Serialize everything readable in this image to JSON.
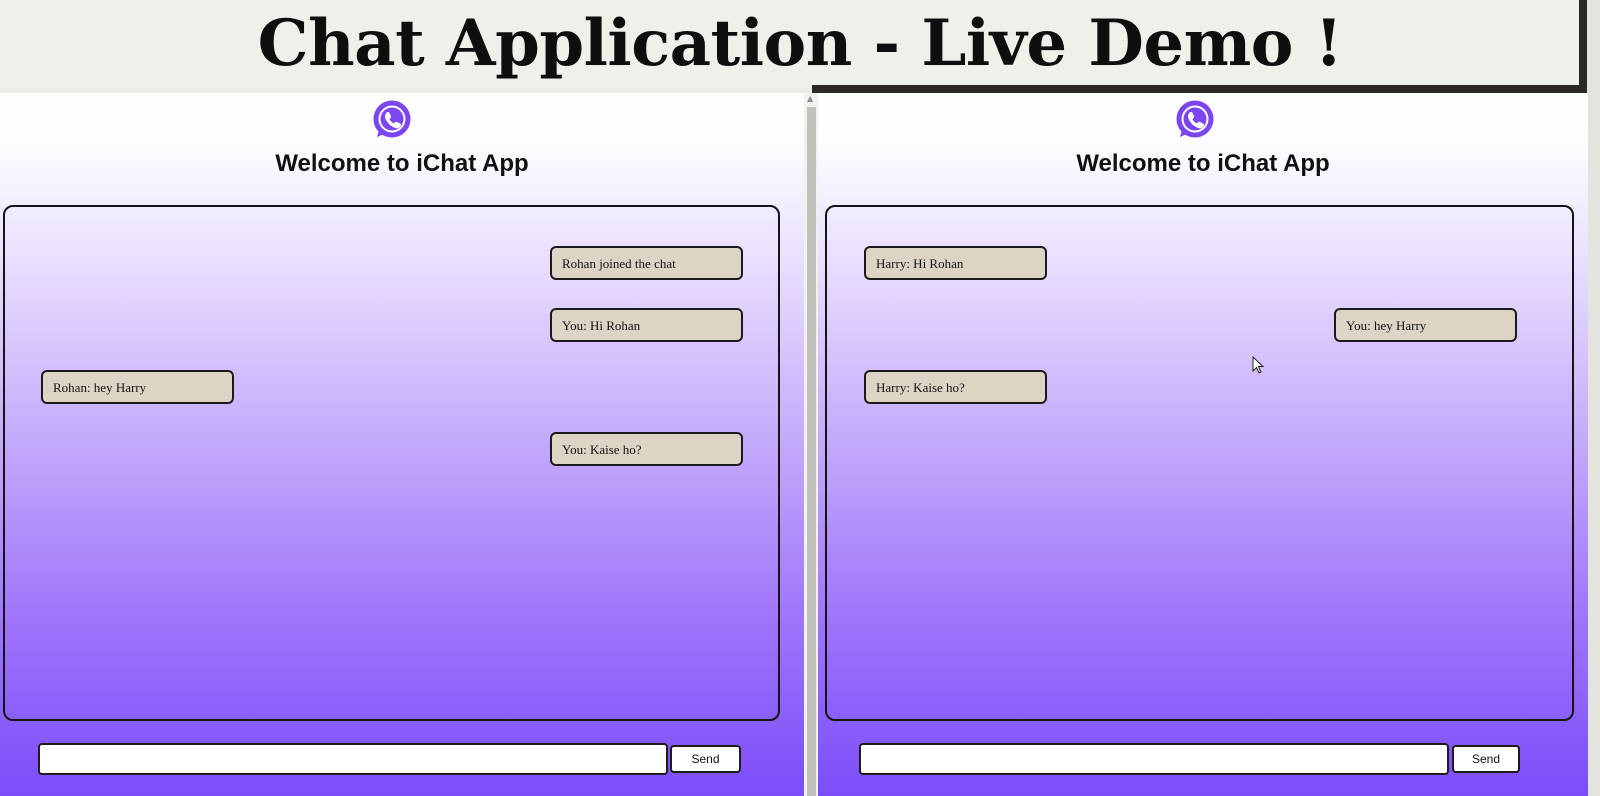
{
  "banner": {
    "title": "Chat Application - Live Demo !"
  },
  "left_window": {
    "logo_icon": "whatsapp-phone-icon",
    "heading": "Welcome to iChat App",
    "messages": [
      {
        "text": "Rohan joined the chat",
        "side": "right"
      },
      {
        "text": "You: Hi Rohan",
        "side": "right"
      },
      {
        "text": "Rohan: hey Harry",
        "side": "left"
      },
      {
        "text": "You: Kaise ho?",
        "side": "right"
      }
    ],
    "input": {
      "value": "",
      "placeholder": ""
    },
    "send_label": "Send"
  },
  "right_window": {
    "logo_icon": "whatsapp-phone-icon",
    "heading": "Welcome to iChat App",
    "messages": [
      {
        "text": "Harry: Hi Rohan",
        "side": "left"
      },
      {
        "text": "You: hey Harry",
        "side": "right"
      },
      {
        "text": "Harry: Kaise ho?",
        "side": "left"
      }
    ],
    "input": {
      "value": "",
      "placeholder": ""
    },
    "send_label": "Send"
  },
  "colors": {
    "accent": "#7c4dfa",
    "logo": "#7b45f0",
    "bubble": "#ddd4c6"
  }
}
